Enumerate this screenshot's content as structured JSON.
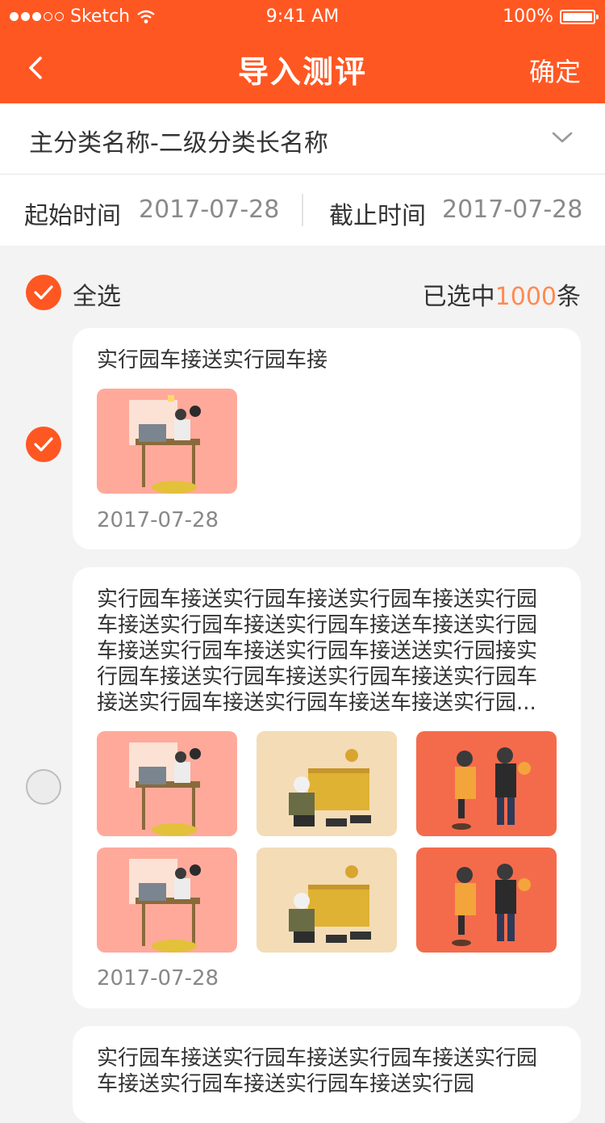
{
  "status_bar": {
    "carrier": "Sketch",
    "time": "9:41 AM",
    "battery": "100%"
  },
  "nav": {
    "title": "导入测评",
    "confirm": "确定"
  },
  "category": {
    "label": "主分类名称-二级分类长名称"
  },
  "dates": {
    "start_label": "起始时间",
    "start_value": "2017-07-28",
    "end_label": "截止时间",
    "end_value": "2017-07-28"
  },
  "selection": {
    "all_label": "全选",
    "count_prefix": "已选中",
    "count": "1000",
    "count_suffix": "条"
  },
  "items": [
    {
      "text": "实行园车接送实行园车接",
      "date": "2017-07-28",
      "selected": true
    },
    {
      "text": "实行园车接送实行园车接送实行园车接送实行园车接送实行园车接送实行园车接送车接送实行园车接送实行园车接送实行园车接送送实行园接实行园车接送实行园车接送实行园车接送实行园车接送实行园车接送实行园车接送车接送实行园...",
      "date": "2017-07-28",
      "selected": false
    },
    {
      "text": "实行园车接送实行园车接送实行园车接送实行园车接送实行园车接送实行园车接送实行园",
      "selected": false
    }
  ],
  "colors": {
    "accent": "#ff5722",
    "highlight": "#ff8a50"
  },
  "icons": [
    "back-arrow-icon",
    "wifi-icon",
    "battery-icon",
    "chevron-down-icon",
    "check-icon"
  ]
}
